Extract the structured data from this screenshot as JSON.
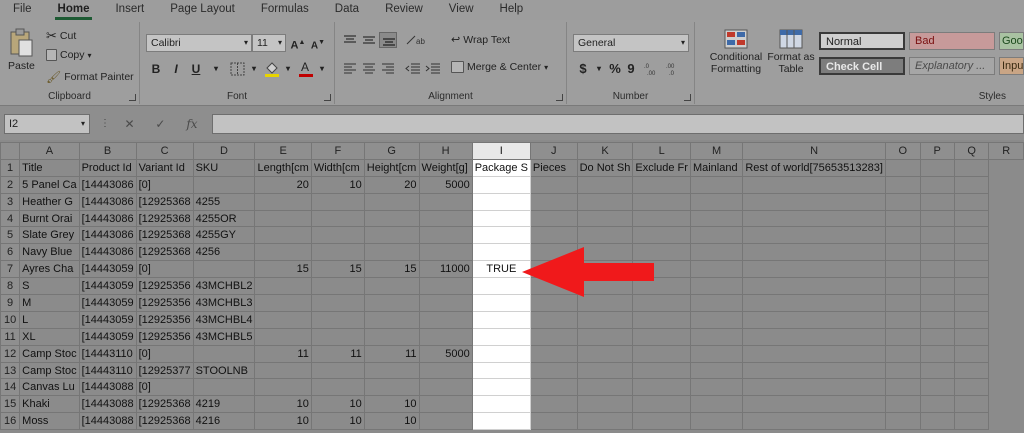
{
  "menu": [
    "File",
    "Home",
    "Insert",
    "Page Layout",
    "Formulas",
    "Data",
    "Review",
    "View",
    "Help"
  ],
  "ribbon": {
    "clipboard": {
      "paste": "Paste",
      "cut": "Cut",
      "copy": "Copy",
      "format_painter": "Format Painter",
      "label": "Clipboard"
    },
    "font": {
      "name": "Calibri",
      "size": "11",
      "label": "Font",
      "bold": "B",
      "italic": "I",
      "underline": "U"
    },
    "alignment": {
      "wrap": "Wrap Text",
      "merge": "Merge & Center",
      "label": "Alignment"
    },
    "number": {
      "format": "General",
      "currency": "$",
      "percent": "%",
      "comma": "9",
      "label": "Number"
    },
    "styles": {
      "conditional": "Conditional Formatting",
      "format_table": "Format as Table",
      "normal": "Normal",
      "bad": "Bad",
      "good": "Goo",
      "check": "Check Cell",
      "explanatory": "Explanatory ...",
      "input": "Inpu",
      "label": "Styles"
    }
  },
  "formula_bar": {
    "name_box": "I2",
    "content": ""
  },
  "sheet": {
    "columns": [
      "A",
      "B",
      "C",
      "D",
      "E",
      "F",
      "G",
      "H",
      "I",
      "J",
      "K",
      "L",
      "M",
      "N",
      "O",
      "P",
      "Q",
      "R"
    ],
    "rows": [
      [
        "1",
        "Title",
        "Product Id",
        "Variant Id",
        "SKU",
        "Length[cm",
        "Width[cm",
        "Height[cm",
        "Weight[g]",
        "Package S",
        "Pieces",
        "Do Not Sh",
        "Exclude Fr",
        "Mainland",
        "Rest of world[75653513283]",
        "",
        "",
        ""
      ],
      [
        "2",
        "5 Panel Ca",
        "[14443086",
        "[0]",
        "",
        "20",
        "10",
        "20",
        "5000",
        "",
        "",
        "",
        "",
        "",
        "",
        "",
        "",
        ""
      ],
      [
        "3",
        "Heather G",
        "[14443086",
        "[12925368",
        "4255",
        "",
        "",
        "",
        "",
        "",
        "",
        "",
        "",
        "",
        "",
        "",
        "",
        ""
      ],
      [
        "4",
        "Burnt Orai",
        "[14443086",
        "[12925368",
        "4255OR",
        "",
        "",
        "",
        "",
        "",
        "",
        "",
        "",
        "",
        "",
        "",
        "",
        ""
      ],
      [
        "5",
        "Slate Grey",
        "[14443086",
        "[12925368",
        "4255GY",
        "",
        "",
        "",
        "",
        "",
        "",
        "",
        "",
        "",
        "",
        "",
        "",
        ""
      ],
      [
        "6",
        "Navy Blue",
        "[14443086",
        "[12925368",
        "4256",
        "",
        "",
        "",
        "",
        "",
        "",
        "",
        "",
        "",
        "",
        "",
        "",
        ""
      ],
      [
        "7",
        "Ayres Cha",
        "[14443059",
        "[0]",
        "",
        "15",
        "15",
        "15",
        "11000",
        "TRUE",
        "",
        "",
        "",
        "",
        "",
        "",
        "",
        ""
      ],
      [
        "8",
        "S",
        "[14443059",
        "[12925356",
        "43MCHBL2",
        "",
        "",
        "",
        "",
        "",
        "",
        "",
        "",
        "",
        "",
        "",
        "",
        ""
      ],
      [
        "9",
        "M",
        "[14443059",
        "[12925356",
        "43MCHBL3",
        "",
        "",
        "",
        "",
        "",
        "",
        "",
        "",
        "",
        "",
        "",
        "",
        ""
      ],
      [
        "10",
        "L",
        "[14443059",
        "[12925356",
        "43MCHBL4",
        "",
        "",
        "",
        "",
        "",
        "",
        "",
        "",
        "",
        "",
        "",
        "",
        ""
      ],
      [
        "11",
        "XL",
        "[14443059",
        "[12925356",
        "43MCHBL5",
        "",
        "",
        "",
        "",
        "",
        "",
        "",
        "",
        "",
        "",
        "",
        "",
        ""
      ],
      [
        "12",
        "Camp Stoc",
        "[14443110",
        "[0]",
        "",
        "11",
        "11",
        "11",
        "5000",
        "",
        "",
        "",
        "",
        "",
        "",
        "",
        "",
        ""
      ],
      [
        "13",
        "Camp Stoc",
        "[14443110",
        "[12925377",
        "STOOLNB",
        "",
        "",
        "",
        "",
        "",
        "",
        "",
        "",
        "",
        "",
        "",
        "",
        ""
      ],
      [
        "14",
        "Canvas Lu",
        "[14443088",
        "[0]",
        "",
        "",
        "",
        "",
        "",
        "",
        "",
        "",
        "",
        "",
        "",
        "",
        "",
        ""
      ],
      [
        "15",
        "Khaki",
        "[14443088",
        "[12925368",
        "4219",
        "10",
        "10",
        "10",
        "",
        "",
        "",
        "",
        "",
        "",
        "",
        "",
        "",
        ""
      ],
      [
        "16",
        "Moss",
        "[14443088",
        "[12925368",
        "4216",
        "10",
        "10",
        "10",
        "",
        "",
        "",
        "",
        "",
        "",
        "",
        "",
        "",
        ""
      ]
    ]
  },
  "colors": {
    "arrow": "#f0191b",
    "selected_column": "#ffffff"
  }
}
